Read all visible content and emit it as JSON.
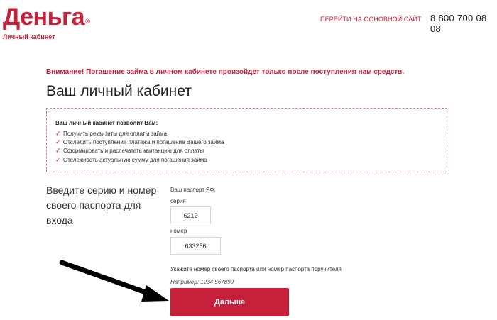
{
  "header": {
    "logo_text": "Деньга",
    "logo_reg": "®",
    "logo_subtitle": "Личный кабинет",
    "main_site_link": "ПЕРЕЙТИ НА ОСНОВНОЙ САЙТ",
    "phone": "8 800 700 08 08"
  },
  "colors": {
    "brand": "#c6203b",
    "arrow": "#000000"
  },
  "notice": "Внимание! Погашение займа в личном кабинете произойдет только после поступления нам средств.",
  "page_title": "Ваш личный кабинет",
  "info": {
    "heading": "Ваш личный кабинет позволит Вам:",
    "check_icon": "check-icon",
    "items": [
      "Получить реквизиты для оплаты займа",
      "Отследить поступление платежа и погашение Вашего займа",
      "Сформировать и распечатать квитанцию для оплаты",
      "Отслеживать актуальную сумму для погашения займа"
    ]
  },
  "form": {
    "prompt": "Введите серию и номер своего паспорта для входа",
    "passport_label": "Ваш паспорт РФ:",
    "series_label": "серия",
    "series_value": "6212",
    "number_label": "номер",
    "number_value": "633256",
    "hint": "Укажите номер своего паспорта или номер паспорта поручителя",
    "example": "Например: 1234 567890",
    "submit_label": "Дальше"
  }
}
